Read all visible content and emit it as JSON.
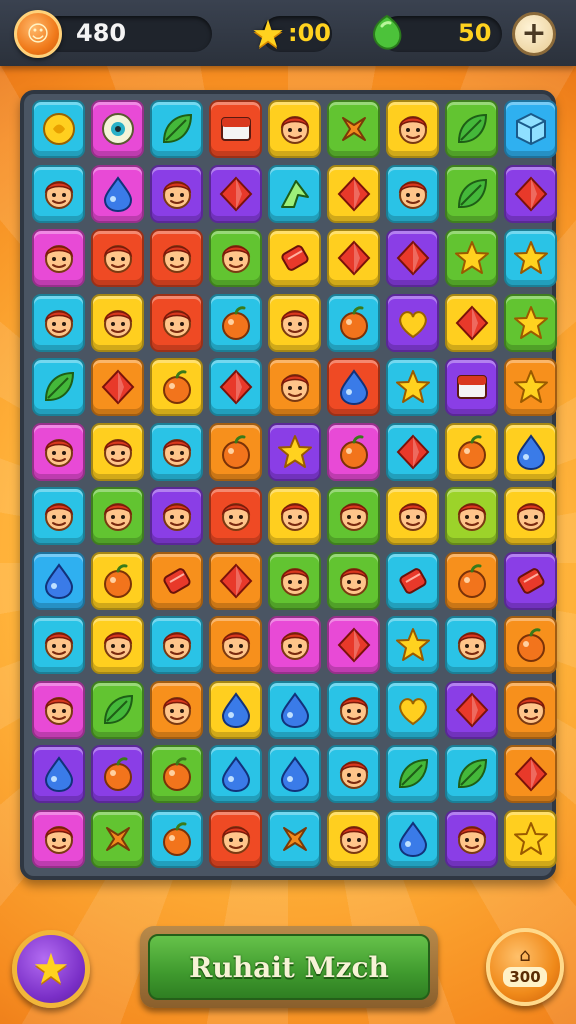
{
  "hud": {
    "coins": "480",
    "stars": ":00",
    "gems": "50"
  },
  "buttons": {
    "main_label": "Ruhait Mzch",
    "coin_button_value": "300"
  },
  "colors": {
    "blue": "#2fb0f0",
    "pink": "#e84ad6",
    "purple": "#8a3ee6",
    "red": "#ef4a24",
    "orange": "#f7901c",
    "yellow": "#ffcf1f",
    "green": "#62c431",
    "lime": "#9cd32a",
    "cyan": "#2ac3e6"
  },
  "board": {
    "rows": [
      [
        [
          "cyan",
          "coin"
        ],
        [
          "pink",
          "eye"
        ],
        [
          "cyan",
          "leaf"
        ],
        [
          "red",
          "box"
        ],
        [
          "yellow",
          "face"
        ],
        [
          "green",
          "cross"
        ],
        [
          "yellow",
          "face"
        ],
        [
          "green",
          "leaf"
        ],
        [
          "blue",
          "cube"
        ]
      ],
      [
        [
          "cyan",
          "face"
        ],
        [
          "pink",
          "drop"
        ],
        [
          "purple",
          "face"
        ],
        [
          "purple",
          "gem"
        ],
        [
          "cyan",
          "arrow"
        ],
        [
          "yellow",
          "gem"
        ],
        [
          "cyan",
          "face"
        ],
        [
          "green",
          "leaf"
        ],
        [
          "purple",
          "gem"
        ]
      ],
      [
        [
          "pink",
          "face"
        ],
        [
          "red",
          "face"
        ],
        [
          "red",
          "face"
        ],
        [
          "green",
          "face"
        ],
        [
          "yellow",
          "candy"
        ],
        [
          "yellow",
          "gem"
        ],
        [
          "purple",
          "gem"
        ],
        [
          "green",
          "star"
        ],
        [
          "cyan",
          "star"
        ]
      ],
      [
        [
          "cyan",
          "face"
        ],
        [
          "yellow",
          "face"
        ],
        [
          "red",
          "face"
        ],
        [
          "cyan",
          "fruit"
        ],
        [
          "yellow",
          "face"
        ],
        [
          "cyan",
          "fruit"
        ],
        [
          "purple",
          "heart"
        ],
        [
          "yellow",
          "gem"
        ],
        [
          "green",
          "star"
        ]
      ],
      [
        [
          "cyan",
          "leaf"
        ],
        [
          "orange",
          "gem"
        ],
        [
          "yellow",
          "fruit"
        ],
        [
          "cyan",
          "gem"
        ],
        [
          "orange",
          "face"
        ],
        [
          "red",
          "drop"
        ],
        [
          "cyan",
          "star"
        ],
        [
          "purple",
          "box"
        ],
        [
          "orange",
          "star"
        ]
      ],
      [
        [
          "pink",
          "face"
        ],
        [
          "yellow",
          "face"
        ],
        [
          "cyan",
          "face"
        ],
        [
          "orange",
          "fruit"
        ],
        [
          "purple",
          "star"
        ],
        [
          "pink",
          "fruit"
        ],
        [
          "cyan",
          "gem"
        ],
        [
          "yellow",
          "fruit"
        ],
        [
          "yellow",
          "drop"
        ]
      ],
      [
        [
          "cyan",
          "face"
        ],
        [
          "green",
          "face"
        ],
        [
          "purple",
          "face"
        ],
        [
          "red",
          "face"
        ],
        [
          "yellow",
          "face"
        ],
        [
          "green",
          "face"
        ],
        [
          "yellow",
          "face"
        ],
        [
          "lime",
          "face"
        ],
        [
          "yellow",
          "face"
        ]
      ],
      [
        [
          "blue",
          "drop"
        ],
        [
          "yellow",
          "fruit"
        ],
        [
          "orange",
          "candy"
        ],
        [
          "orange",
          "gem"
        ],
        [
          "green",
          "face"
        ],
        [
          "green",
          "face"
        ],
        [
          "cyan",
          "candy"
        ],
        [
          "orange",
          "fruit"
        ],
        [
          "purple",
          "candy"
        ]
      ],
      [
        [
          "cyan",
          "face"
        ],
        [
          "yellow",
          "face"
        ],
        [
          "cyan",
          "face"
        ],
        [
          "orange",
          "face"
        ],
        [
          "pink",
          "face"
        ],
        [
          "pink",
          "gem"
        ],
        [
          "cyan",
          "star"
        ],
        [
          "cyan",
          "face"
        ],
        [
          "orange",
          "fruit"
        ]
      ],
      [
        [
          "pink",
          "face"
        ],
        [
          "green",
          "leaf"
        ],
        [
          "orange",
          "face"
        ],
        [
          "yellow",
          "drop"
        ],
        [
          "cyan",
          "drop"
        ],
        [
          "cyan",
          "face"
        ],
        [
          "cyan",
          "heart"
        ],
        [
          "purple",
          "gem"
        ],
        [
          "orange",
          "face"
        ]
      ],
      [
        [
          "purple",
          "drop"
        ],
        [
          "purple",
          "fruit"
        ],
        [
          "green",
          "fruit"
        ],
        [
          "cyan",
          "drop"
        ],
        [
          "cyan",
          "drop"
        ],
        [
          "cyan",
          "face"
        ],
        [
          "cyan",
          "leaf"
        ],
        [
          "cyan",
          "leaf"
        ],
        [
          "orange",
          "gem"
        ]
      ],
      [
        [
          "pink",
          "face"
        ],
        [
          "green",
          "cross"
        ],
        [
          "cyan",
          "fruit"
        ],
        [
          "red",
          "face"
        ],
        [
          "cyan",
          "cross"
        ],
        [
          "yellow",
          "face"
        ],
        [
          "cyan",
          "drop"
        ],
        [
          "purple",
          "face"
        ],
        [
          "yellow",
          "star"
        ]
      ]
    ]
  }
}
